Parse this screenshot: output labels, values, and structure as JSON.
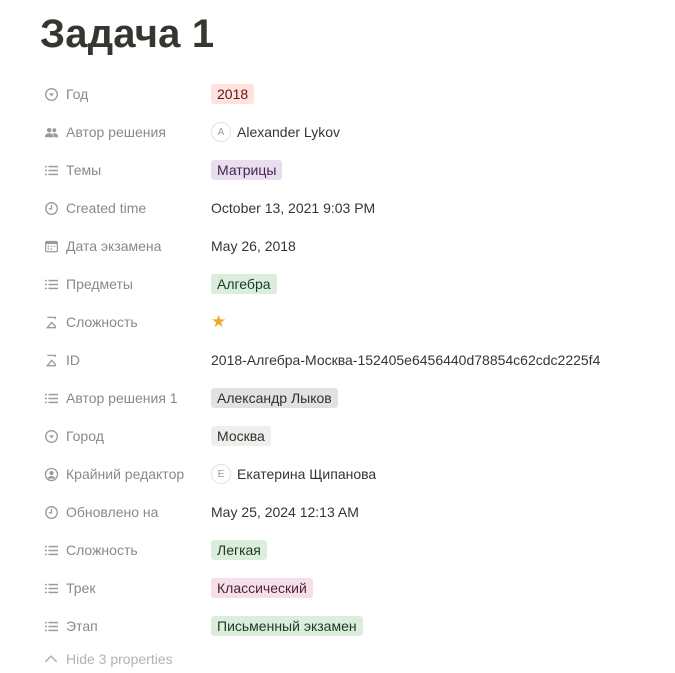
{
  "page": {
    "title": "Задача 1"
  },
  "colors": {
    "tag_red": "#ffe2dd",
    "tag_purple": "#e8deee",
    "tag_green": "#dbeddb",
    "tag_gray": "#e3e2e0",
    "tag_gray_light": "#eeeeec",
    "tag_pink": "#f5e0e9",
    "star": "#f0a92b"
  },
  "properties": [
    {
      "icon": "select-icon",
      "label": "Год",
      "value": "2018",
      "kind": "tag",
      "color": "red"
    },
    {
      "icon": "people-icon",
      "label": "Автор решения",
      "value": "Alexander Lykov",
      "kind": "person",
      "initial": "A"
    },
    {
      "icon": "list-icon",
      "label": "Темы",
      "value": "Матрицы",
      "kind": "tag",
      "color": "purple"
    },
    {
      "icon": "clock-icon",
      "label": "Created time",
      "value": "October 13, 2021 9:03 PM",
      "kind": "text"
    },
    {
      "icon": "calendar-icon",
      "label": "Дата экзамена",
      "value": "May 26, 2018",
      "kind": "text"
    },
    {
      "icon": "list-icon",
      "label": "Предметы",
      "value": "Алгебра",
      "kind": "tag",
      "color": "green"
    },
    {
      "icon": "sigma-icon",
      "label": "Сложность",
      "value": "★",
      "kind": "star",
      "rating": 1
    },
    {
      "icon": "sigma-icon",
      "label": "ID",
      "value": "2018-Алгебра-Москва-152405e6456440d78854c62cdc2225f4",
      "kind": "text"
    },
    {
      "icon": "list-icon",
      "label": "Автор решения 1",
      "value": "Александр Лыков",
      "kind": "tag",
      "color": "gray"
    },
    {
      "icon": "select-icon",
      "label": "Город",
      "value": "Москва",
      "kind": "tag",
      "color": "gray_light"
    },
    {
      "icon": "person-circle-icon",
      "label": "Крайний редактор",
      "value": "Екатерина Щипанова",
      "kind": "person",
      "initial": "E"
    },
    {
      "icon": "clock-icon",
      "label": "Обновлено на",
      "value": "May 25, 2024 12:13 AM",
      "kind": "text"
    },
    {
      "icon": "list-icon",
      "label": "Сложность",
      "value": "Легкая",
      "kind": "tag",
      "color": "green"
    },
    {
      "icon": "list-icon",
      "label": "Трек",
      "value": "Классический",
      "kind": "tag",
      "color": "pink"
    },
    {
      "icon": "list-icon",
      "label": "Этап",
      "value": "Письменный экзамен",
      "kind": "tag",
      "color": "green"
    }
  ],
  "hide_toggle": {
    "icon": "chevron-up-icon",
    "label": "Hide 3 properties"
  }
}
